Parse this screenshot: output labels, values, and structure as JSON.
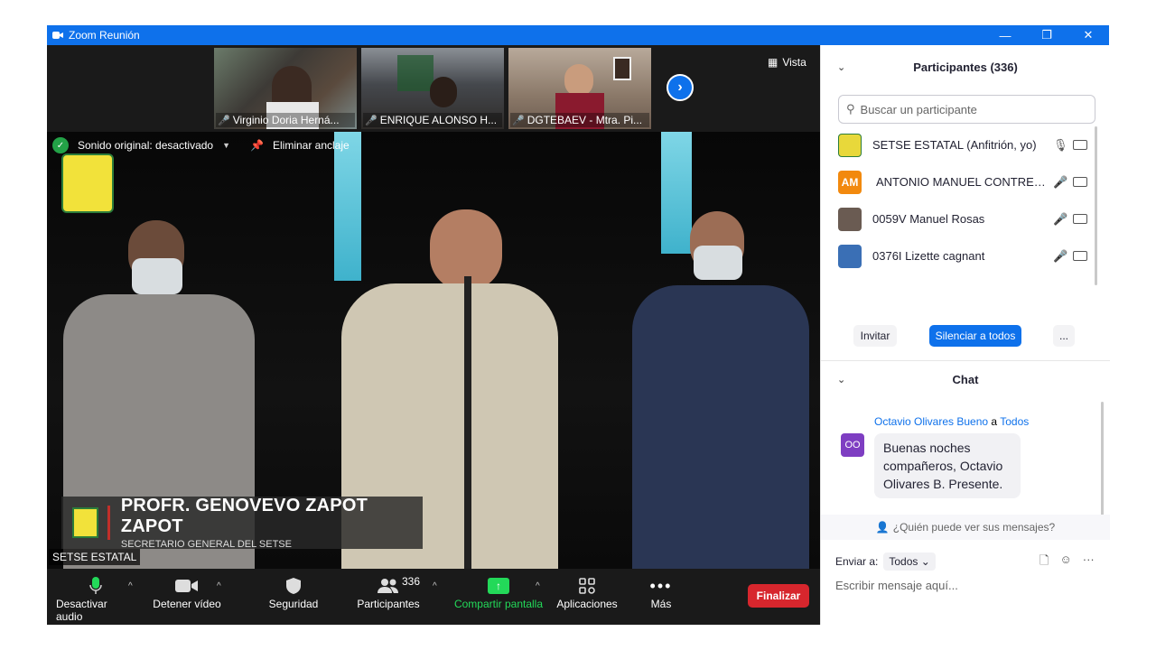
{
  "window": {
    "title": "Zoom Reunión",
    "controls": [
      "—",
      "❐",
      "✕"
    ]
  },
  "thumbnails": [
    {
      "name": "Virginio Doria Herná...",
      "muted": true
    },
    {
      "name": "ENRIQUE ALONSO H...",
      "muted": true
    },
    {
      "name": "DGTEBAEV - Mtra. Pi...",
      "muted": true
    }
  ],
  "view_label": "Vista",
  "main_video": {
    "original_sound": "Sonido original: desactivado",
    "unpin": "Eliminar anclaje",
    "lower_third_name": "PROFR. GENOVEVO ZAPOT ZAPOT",
    "lower_third_role": "SECRETARIO GENERAL DEL SETSE",
    "speaker": "SETSE ESTATAL"
  },
  "toolbar": {
    "mute": "Desactivar audio",
    "video": "Detener vídeo",
    "security": "Seguridad",
    "participants": "Participantes",
    "participant_count": "336",
    "share": "Compartir pantalla",
    "apps": "Aplicaciones",
    "more": "Más",
    "end": "Finalizar"
  },
  "participants_panel": {
    "title": "Participantes (336)",
    "search_placeholder": "Buscar un participante",
    "rows": [
      {
        "initials": "",
        "name": "SETSE ESTATAL (Anfitrión, yo)",
        "muted": false,
        "avatar_color": "#e8d83a"
      },
      {
        "initials": "AM",
        "name": "ANTONIO MANUEL CONTRERAS",
        "muted": true,
        "avatar_color": "#f2890e"
      },
      {
        "initials": "",
        "name": "0059V Manuel Rosas",
        "muted": true,
        "avatar_color": "#6a5b52"
      },
      {
        "initials": "",
        "name": "0376I Lizette cagnant",
        "muted": true,
        "avatar_color": "#3a6fb5"
      }
    ],
    "invite": "Invitar",
    "mute_all": "Silenciar a todos",
    "more": "..."
  },
  "chat": {
    "title": "Chat",
    "sender": "Octavio Olivares Bueno",
    "to_word": "a",
    "recipient": "Todos",
    "sender_initials": "OO",
    "message": "Buenas noches compañeros, Octavio Olivares B. Presente.",
    "who_sees": "¿Quién puede ver sus mensajes?",
    "send_to_label": "Enviar a:",
    "send_to_value": "Todos",
    "input_placeholder": "Escribir mensaje aquí..."
  }
}
